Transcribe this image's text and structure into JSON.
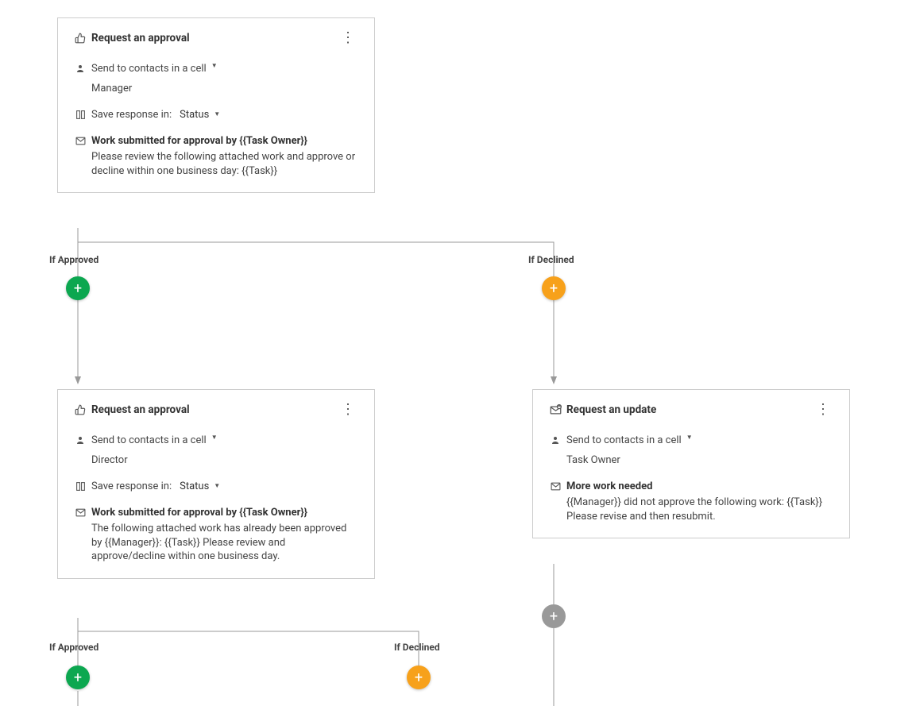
{
  "labels": {
    "if_approved": "If Approved",
    "if_declined": "If Declined",
    "send_to": "Send to contacts in a cell",
    "save_in": "Save response in:"
  },
  "cards": {
    "top": {
      "title": "Request an approval",
      "recipient": "Manager",
      "status_field": "Status",
      "subject": "Work submitted for approval by {{Task Owner}}",
      "body": "Please review the following attached work and approve or decline within one business day: {{Task}}"
    },
    "left": {
      "title": "Request an approval",
      "recipient": "Director",
      "status_field": "Status",
      "subject": "Work submitted for approval by {{Task Owner}}",
      "body": "The following attached work has already been approved by {{Manager}}: {{Task}} Please review and approve/decline within one business day."
    },
    "right": {
      "title": "Request an update",
      "recipient": "Task Owner",
      "subject": "More work needed",
      "body": "{{Manager}} did not approve the following work: {{Task}} Please revise and then resubmit."
    }
  }
}
